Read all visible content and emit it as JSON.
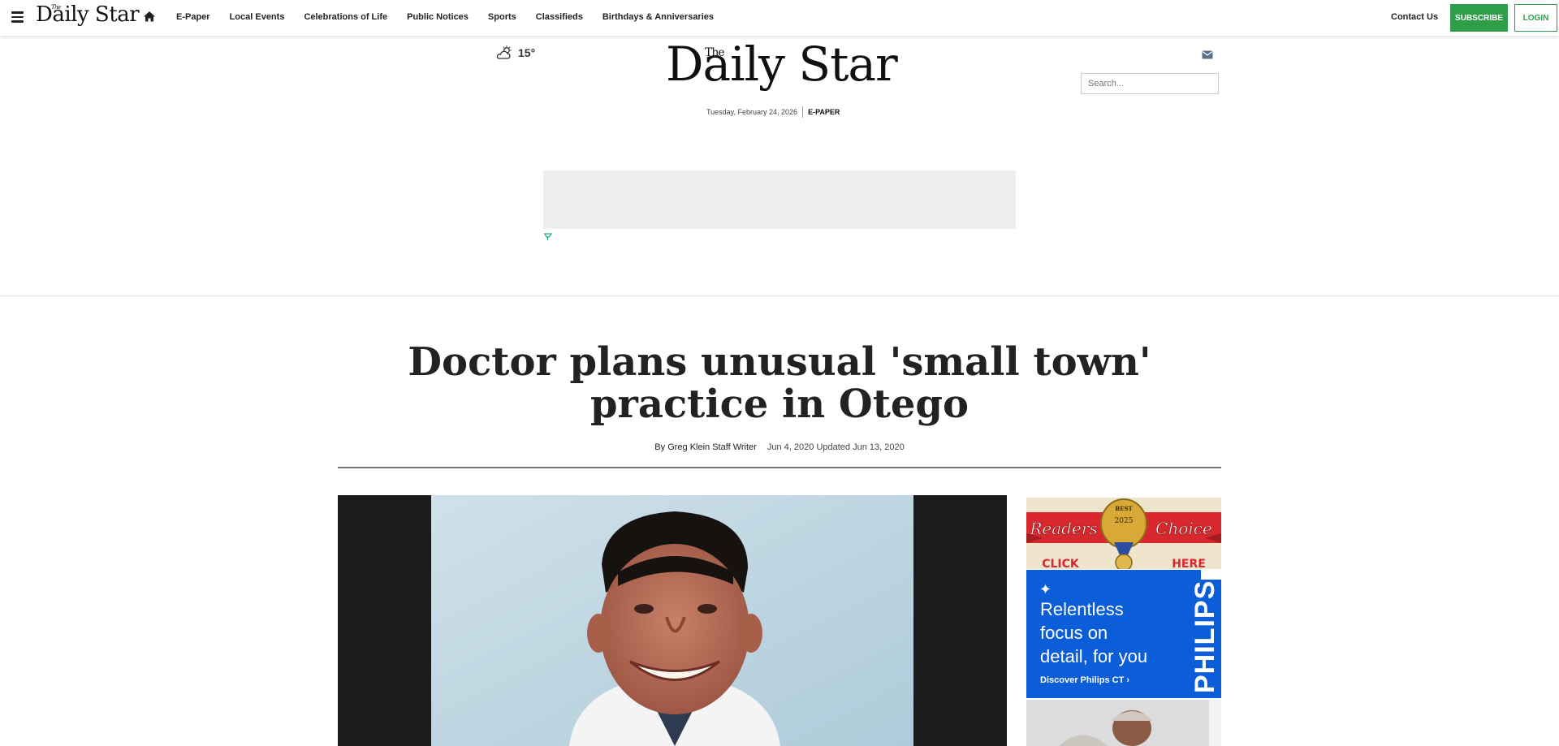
{
  "nav": {
    "logo": "Daily Star",
    "logo_the": "The",
    "links": [
      "E-Paper",
      "Local Events",
      "Celebrations of Life",
      "Public Notices",
      "Sports",
      "Classifieds",
      "Birthdays & Anniversaries"
    ],
    "contact": "Contact Us",
    "subscribe": "SUBSCRIBE",
    "login": "LOGIN"
  },
  "masthead": {
    "temperature": "15°",
    "logo": "Daily Star",
    "logo_the": "The",
    "date": "Tuesday, February 24, 2026",
    "epaper": "E-PAPER",
    "search_placeholder": "Search..."
  },
  "article": {
    "headline": "Doctor plans unusual 'small town' practice in Otego",
    "author": "By Greg Klein Staff Writer",
    "dates": "Jun 4, 2020 Updated Jun 13, 2020"
  },
  "ads": {
    "readers_choice": {
      "badge_top": "BEST",
      "badge_year": "2025",
      "left": "Readers",
      "right": "Choice",
      "click_left": "CLICK",
      "click_right": "HERE"
    },
    "philips": {
      "line1": "Relentless",
      "line2": "focus on",
      "line3": "detail, for you",
      "cta": "Discover Philips CT ›",
      "brand": "PHILIPS"
    }
  },
  "colors": {
    "accent_green": "#2e9e49",
    "philips_blue": "#0b5ed7"
  }
}
